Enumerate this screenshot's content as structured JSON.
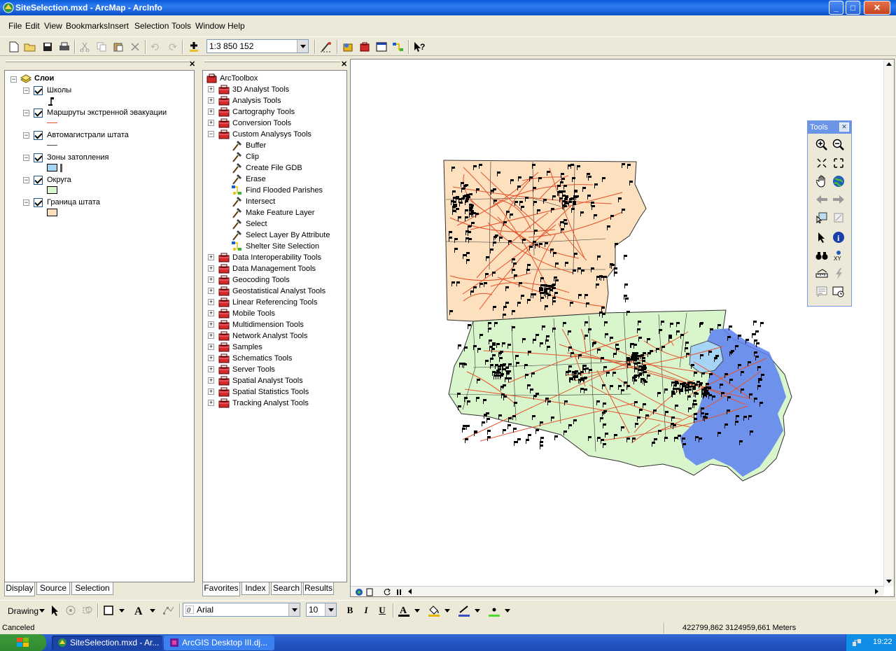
{
  "window": {
    "title": "SiteSelection.mxd - ArcMap - ArcInfo",
    "buttons": [
      "_",
      "□",
      "✕"
    ]
  },
  "menu": [
    {
      "label": "File",
      "key": "F"
    },
    {
      "label": "Edit",
      "key": "E"
    },
    {
      "label": "View",
      "key": "V"
    },
    {
      "label": "Bookmarks",
      "key": "B"
    },
    {
      "label": "Insert",
      "key": "I"
    },
    {
      "label": "Selection",
      "key": "S"
    },
    {
      "label": "Tools",
      "key": "T"
    },
    {
      "label": "Window",
      "key": "W"
    },
    {
      "label": "Help",
      "key": "H"
    }
  ],
  "toolbar": {
    "scale": "1:3 850 152"
  },
  "toc": {
    "root": "Слои",
    "layers": [
      {
        "name": "Школы",
        "symbol": "flag",
        "color": "#000000"
      },
      {
        "name": "Маршруты экстренной эвакуации",
        "symbol": "line",
        "color": "#e3542d"
      },
      {
        "name": "Автомагистрали штата",
        "symbol": "line",
        "color": "#4a4a4a"
      },
      {
        "name": "Зоны затопления",
        "symbol": "fill",
        "color": "#a6d4f5"
      },
      {
        "name": "Округа",
        "symbol": "fill",
        "color": "#d9f5cc"
      },
      {
        "name": "Граница штата",
        "symbol": "fill",
        "color": "#fde0bd"
      }
    ],
    "tabs": [
      "Display",
      "Source",
      "Selection"
    ]
  },
  "toolbox": {
    "root": "ArcToolbox",
    "items_before": [
      "3D Analyst Tools",
      "Analysis Tools",
      "Cartography Tools",
      "Conversion Tools"
    ],
    "expanded": "Custom Analysys Tools",
    "children": [
      {
        "name": "Buffer",
        "kind": "tool"
      },
      {
        "name": "Clip",
        "kind": "tool"
      },
      {
        "name": "Create File GDB",
        "kind": "tool"
      },
      {
        "name": "Erase",
        "kind": "tool"
      },
      {
        "name": "Find Flooded Parishes",
        "kind": "model"
      },
      {
        "name": "Intersect",
        "kind": "tool"
      },
      {
        "name": "Make Feature Layer",
        "kind": "tool"
      },
      {
        "name": "Select",
        "kind": "tool"
      },
      {
        "name": "Select Layer By Attribute",
        "kind": "tool"
      },
      {
        "name": "Shelter Site Selection",
        "kind": "model"
      }
    ],
    "items_after": [
      "Data Interoperability Tools",
      "Data Management Tools",
      "Geocoding Tools",
      "Geostatistical Analyst Tools",
      "Linear Referencing Tools",
      "Mobile Tools",
      "Multidimension Tools",
      "Network Analyst Tools",
      "Samples",
      "Schematics Tools",
      "Server Tools",
      "Spatial Analyst Tools",
      "Spatial Statistics Tools",
      "Tracking Analyst Tools"
    ],
    "tabs": [
      "Favorites",
      "Index",
      "Search",
      "Results"
    ]
  },
  "tools_window": {
    "title": "Tools"
  },
  "drawing": {
    "label": "Drawing",
    "font": "Arial",
    "size": "10",
    "bold": "B",
    "italic": "I",
    "underline": "U"
  },
  "status": {
    "message": "Canceled",
    "coords": "422799,862  3124959,661 Meters"
  },
  "taskbar": {
    "tasks": [
      "SiteSelection.mxd - Ar...",
      "ArcGIS Desktop III.dj..."
    ],
    "clock": "19:22"
  },
  "colors": {
    "north_fill": "#fde0bd",
    "parish_fill": "#d9f5cc",
    "flood": "#5a7ff0",
    "route": "#e3542d"
  }
}
